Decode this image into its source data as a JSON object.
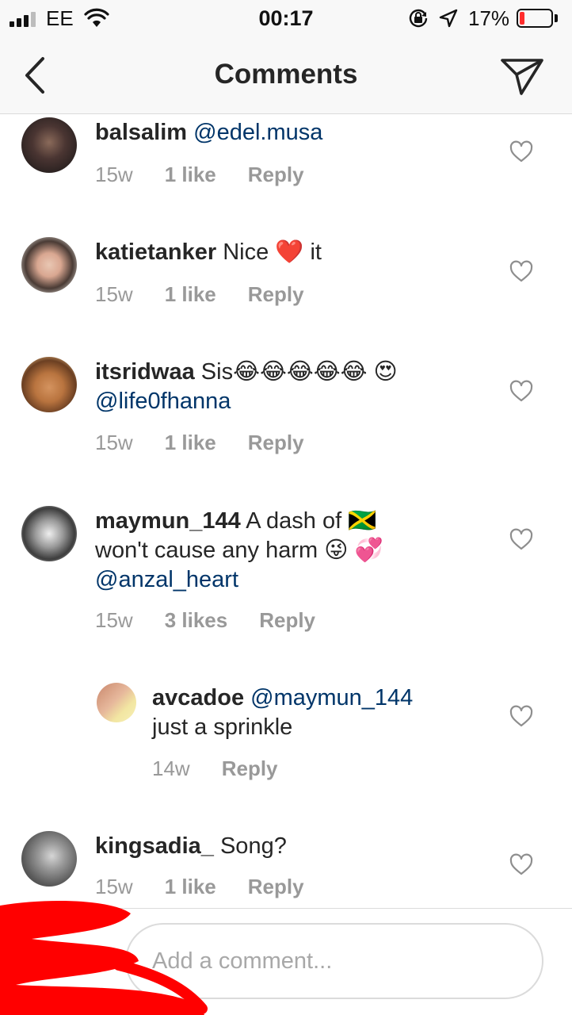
{
  "status_bar": {
    "carrier": "EE",
    "time": "00:17",
    "battery_percent": "17%",
    "battery_level": 0.17
  },
  "header": {
    "title": "Comments"
  },
  "comments": [
    {
      "username": "balsalim",
      "text": "",
      "mention": "@edel.musa",
      "time": "15w",
      "likes": "1 like",
      "reply": "Reply"
    },
    {
      "username": "katietanker",
      "text": "Nice ❤️ it",
      "mention": "",
      "time": "15w",
      "likes": "1 like",
      "reply": "Reply"
    },
    {
      "username": "itsridwaa",
      "text": "Sis😂😂😂😂😂 😍",
      "mention": "@life0fhanna",
      "time": "15w",
      "likes": "1 like",
      "reply": "Reply"
    },
    {
      "username": "maymun_144",
      "text": "A dash of 🇯🇲 won't cause any harm 😜 💞",
      "mention": "@anzal_heart",
      "time": "15w",
      "likes": "3 likes",
      "reply": "Reply"
    },
    {
      "username": "avcadoe",
      "text": "just a sprinkle",
      "mention": "@maymun_144",
      "time": "14w",
      "likes": "",
      "reply": "Reply"
    },
    {
      "username": "kingsadia_",
      "text": "Song?",
      "mention": "",
      "time": "15w",
      "likes": "1 like",
      "reply": "Reply"
    }
  ],
  "composer": {
    "placeholder": "Add a comment..."
  }
}
